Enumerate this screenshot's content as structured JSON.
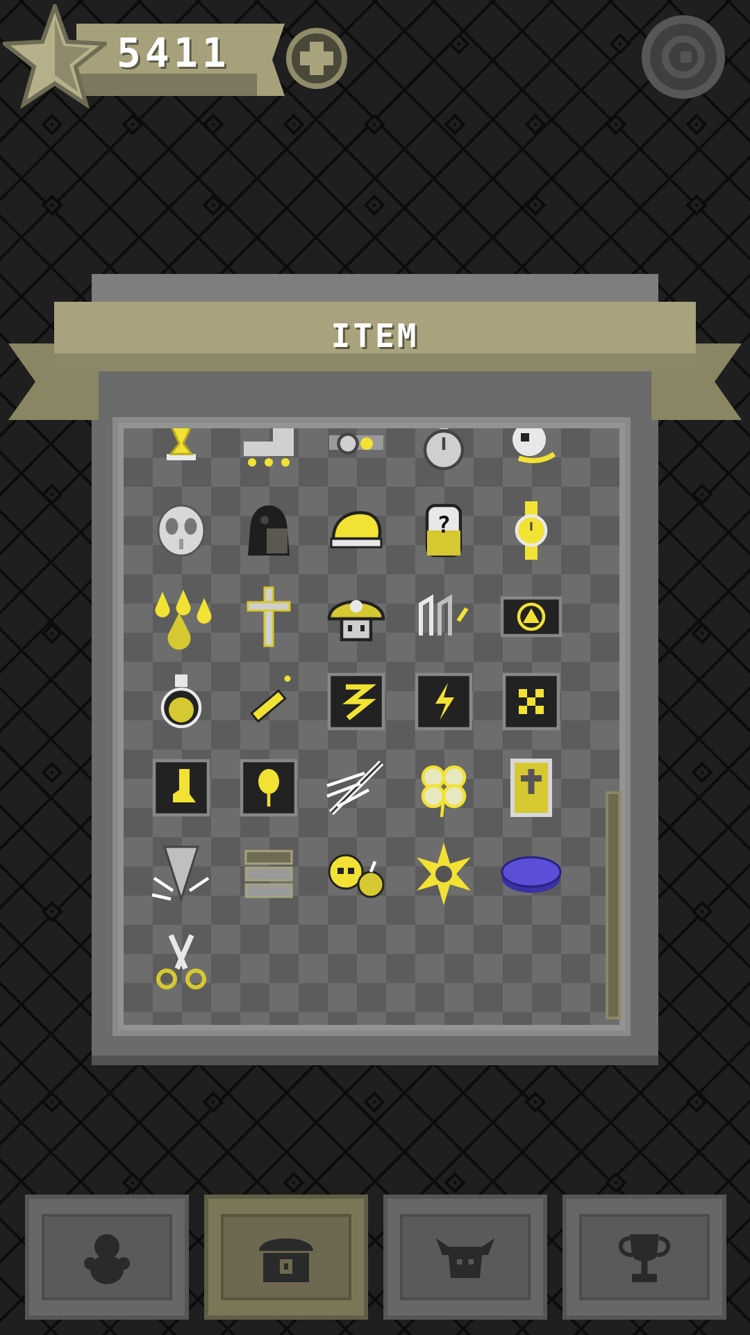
{
  "header": {
    "score": "5411",
    "icons": {
      "star": "star-icon",
      "plus": "plus-icon",
      "settings": "settings-icon"
    }
  },
  "panel": {
    "title": "ITEM",
    "items": [
      "hourglass-icon",
      "roller-skate-icon",
      "goggles-icon",
      "stopwatch-icon",
      "gold-skull-icon",
      "mask-icon",
      "cloak-icon",
      "helmet-icon",
      "mystery-can-icon",
      "wristwatch-icon",
      "drops-icon",
      "cross-icon",
      "mushroom-icon",
      "chain-icon",
      "emblem-card-icon",
      "potion-icon",
      "syringe-icon",
      "swirl-book-icon",
      "lightning-book-icon",
      "grid-book-icon",
      "boot-book-icon",
      "balloon-book-icon",
      "sword-slash-icon",
      "clover-icon",
      "gold-tablet-icon",
      "shield-blade-icon",
      "books-icon",
      "bombs-icon",
      "sun-icon",
      "purple-disc-icon",
      "scissors-icon"
    ]
  },
  "nav": {
    "tabs": [
      {
        "icon": "character-icon",
        "active": false
      },
      {
        "icon": "item-chest-icon",
        "active": true
      },
      {
        "icon": "monster-icon",
        "active": false
      },
      {
        "icon": "trophy-icon",
        "active": false
      }
    ]
  },
  "colors": {
    "accent_gold": "#f2e233",
    "ribbon": "#a8a37d",
    "panel": "#6b6b6b",
    "purple_item": "#5b4fd8"
  }
}
